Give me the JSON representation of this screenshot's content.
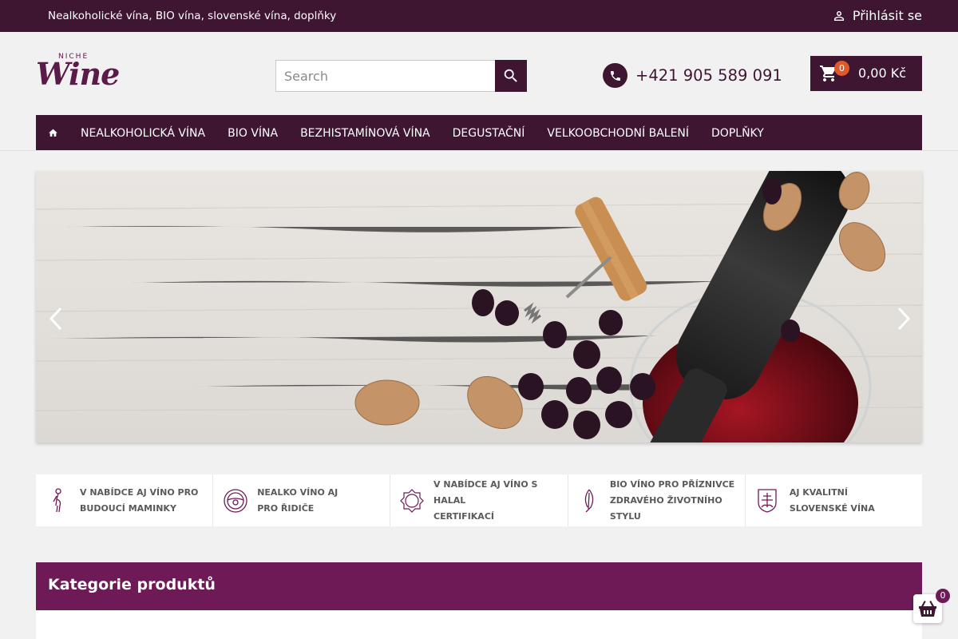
{
  "topbar": {
    "tagline": "Nealkoholické vína, BIO vína, slovenské vína, doplňky",
    "login_label": "Přihlásit se"
  },
  "logo": {
    "small": "NICHE",
    "main": "Wine"
  },
  "search": {
    "placeholder": "Search",
    "value": ""
  },
  "phone": {
    "number": "+421 905 589 091"
  },
  "cart": {
    "count": "0",
    "total": "0,00 Kč"
  },
  "nav": {
    "items": [
      {
        "label": "NEALKOHOLICKÁ VÍNA"
      },
      {
        "label": "BIO VÍNA"
      },
      {
        "label": "BEZHISTAMÍNOVÁ VÍNA"
      },
      {
        "label": "DEGUSTAČNÍ"
      },
      {
        "label": "VELKOOBCHODNÍ BALENÍ"
      },
      {
        "label": "DOPLŇKY"
      }
    ]
  },
  "features": [
    {
      "line1": "V NABÍDCE AJ VÍNO PRO",
      "line2": "BUDOUCÍ MAMINKY",
      "icon": "pregnant-woman-icon"
    },
    {
      "line1": "NEALKO VÍNO AJ",
      "line2": "PRO ŘIDIČE",
      "icon": "steering-wheel-icon"
    },
    {
      "line1": "V NABÍDCE AJ VÍNO S HALAL",
      "line2": "CERTIFIKACÍ",
      "icon": "halal-icon"
    },
    {
      "line1": "BIO VÍNO PRO PŘÍZNIVCE",
      "line2": "ZDRAVÉHO ŽIVOTNÍHO STYLU",
      "icon": "leaf-icon"
    },
    {
      "line1": "AJ KVALITNÍ",
      "line2": "SLOVENSKÉ VÍNA",
      "icon": "slovak-emblem-icon"
    }
  ],
  "categories": {
    "title": "Kategorie produktů"
  },
  "basket": {
    "count": "0"
  },
  "colors": {
    "primary": "#3f1632",
    "accent": "#6e1a56",
    "badge": "#e0592a"
  }
}
